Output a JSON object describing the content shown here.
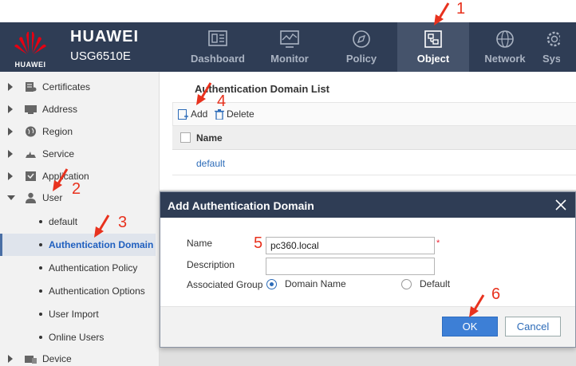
{
  "header": {
    "logo_text": "HUAWEI",
    "brand_name": "HUAWEI",
    "model": "USG6510E",
    "nav": [
      {
        "label": "Dashboard",
        "icon": "dashboard-icon"
      },
      {
        "label": "Monitor",
        "icon": "monitor-icon"
      },
      {
        "label": "Policy",
        "icon": "compass-icon"
      },
      {
        "label": "Object",
        "icon": "object-icon",
        "active": true
      },
      {
        "label": "Network",
        "icon": "globe-icon"
      },
      {
        "label": "System",
        "icon": "gear-icon"
      }
    ]
  },
  "sidebar": {
    "items": [
      {
        "label": "Certificates"
      },
      {
        "label": "Address"
      },
      {
        "label": "Region"
      },
      {
        "label": "Service"
      },
      {
        "label": "Application"
      },
      {
        "label": "User"
      }
    ],
    "user_children": [
      {
        "label": "default"
      },
      {
        "label": "Authentication Domain",
        "active": true
      },
      {
        "label": "Authentication Policy"
      },
      {
        "label": "Authentication Options"
      },
      {
        "label": "User Import"
      },
      {
        "label": "Online Users"
      }
    ],
    "device_label": "Device"
  },
  "main": {
    "title": "Authentication Domain List",
    "toolbar": {
      "add": "Add",
      "delete": "Delete"
    },
    "table": {
      "column": "Name",
      "rows": [
        "default"
      ]
    }
  },
  "dialog": {
    "title": "Add Authentication Domain",
    "name_label": "Name",
    "name_value": "pc360.local",
    "required_mark": "*",
    "description_label": "Description",
    "description_value": "",
    "group_label": "Associated Group",
    "option_domain": "Domain Name",
    "option_default": "Default",
    "ok": "OK",
    "cancel": "Cancel"
  },
  "annotations": [
    "1",
    "2",
    "3",
    "4",
    "5",
    "6"
  ],
  "colors": {
    "header": "#2f3d55",
    "accent": "#3d7fd6",
    "annotation": "#e8321e"
  }
}
